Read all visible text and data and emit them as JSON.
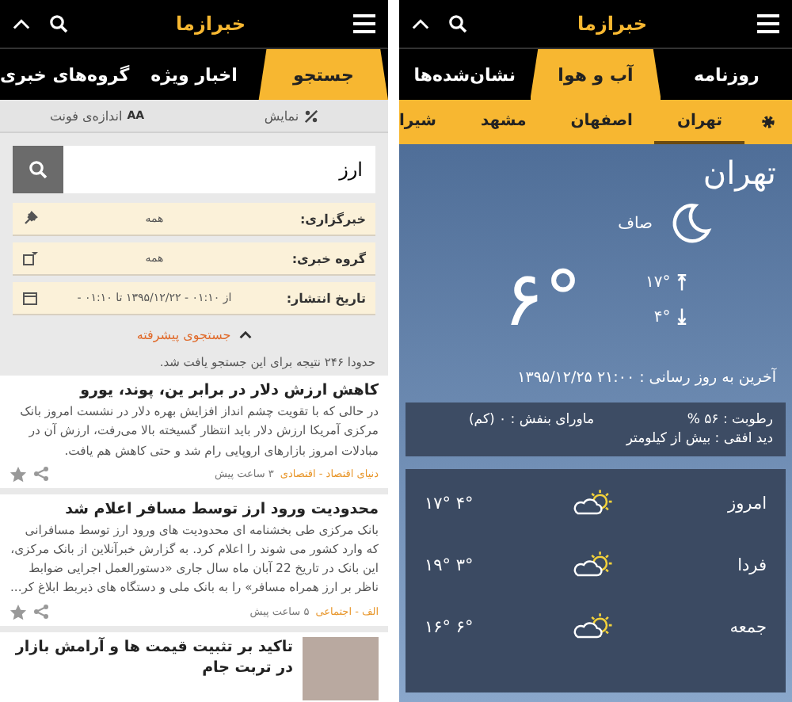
{
  "search_screen": {
    "header": {
      "logo": "خبرازما"
    },
    "tabs": [
      {
        "label": "جستجو",
        "selected": true
      },
      {
        "label": "اخبار ویژه",
        "selected": false
      },
      {
        "label": "گروه‌های خبری",
        "selected": false
      }
    ],
    "toolbar": [
      {
        "kind": "display",
        "label": "نمایش"
      },
      {
        "kind": "font",
        "badge": "AA",
        "label": "اندازه‌ی فونت"
      }
    ],
    "search": {
      "value": "ارز"
    },
    "filters": [
      {
        "kind": "source",
        "label": "خبرگزاری:",
        "value": "همه"
      },
      {
        "kind": "group",
        "label": "گروه خبری:",
        "value": "همه"
      },
      {
        "kind": "date",
        "label": "تاریخ انتشار:",
        "value": "از ۰۱:۱۰ - ۱۳۹۵/۱۲/۲۲ تا ۰۱:۱۰ -"
      }
    ],
    "advanced": {
      "label": "جستجوی پیشرفته",
      "expanded": true
    },
    "result_count": "حدودا ۲۴۶ نتیجه برای این جستجو یافت شد.",
    "news": [
      {
        "kind": "text",
        "title": "کاهش ارزش دلار در برابر ین، پوند، یورو",
        "body": "در حالی که با تقویت چشم انداز افزایش بهره دلار در نشست امروز بانک مرکزی آمریکا ارزش دلار باید انتظار گسیخته بالا می‌رفت، ارزش آن در مبادلات امروز بازارهای اروپایی رام شد و حتی کاهش هم یافت.",
        "source": "دنیای اقتصاد - اقتصادی",
        "time": "۳ ساعت پیش"
      },
      {
        "kind": "text",
        "title": "محدودیت ورود ارز توسط مسافر اعلام شد",
        "body": "بانک مرکزی طی بخشنامه ای محدودیت های ورود ارز توسط مسافرانی که وارد کشور می شوند را اعلام کرد. به گزارش خبرآنلاین از بانک مرکزی، این بانک در تاریخ 22 آبان ماه سال جاری «دستورالعمل اجرایی ضوابط ناظر بر ارز همراه مسافر» را به بانک ملی و دستگاه های ذیربط ابلاغ کر...",
        "source": "الف - اجتماعی",
        "time": "۵ ساعت پیش"
      },
      {
        "kind": "image",
        "title": "تاکید بر تثبیت قیمت ها و آرامش بازار در تربت جام"
      }
    ]
  },
  "weather_screen": {
    "header": {
      "logo": "خبرازما"
    },
    "tabs": [
      {
        "label": "روزنامه",
        "selected": false
      },
      {
        "label": "آب و هوا",
        "selected": true
      },
      {
        "label": "نشان‌شده‌ها",
        "selected": false
      }
    ],
    "cities": [
      {
        "label": "تهران",
        "selected": true
      },
      {
        "label": "اصفهان",
        "selected": false
      },
      {
        "label": "مشهد",
        "selected": false
      },
      {
        "label": "شیرا",
        "selected": false
      }
    ],
    "weather": {
      "city": "تهران",
      "condition": "صاف",
      "temperature": "۶°",
      "high": "۱۷°",
      "low": "۴°",
      "updated": "آخرین به روز رسانی : ۲۱:۰۰ ۱۳۹۵/۱۲/۲۵",
      "details": [
        "رطوبت : ۵۶ %",
        "ماورای بنفش : ۰ (کم)",
        "دید افقی : بیش از کیلومتر"
      ],
      "forecast": [
        {
          "day": "امروز",
          "temps": "۱۷° ۴°"
        },
        {
          "day": "فردا",
          "temps": "۱۹° ۳°"
        },
        {
          "day": "جمعه",
          "temps": "۱۶° ۶°"
        }
      ]
    }
  }
}
